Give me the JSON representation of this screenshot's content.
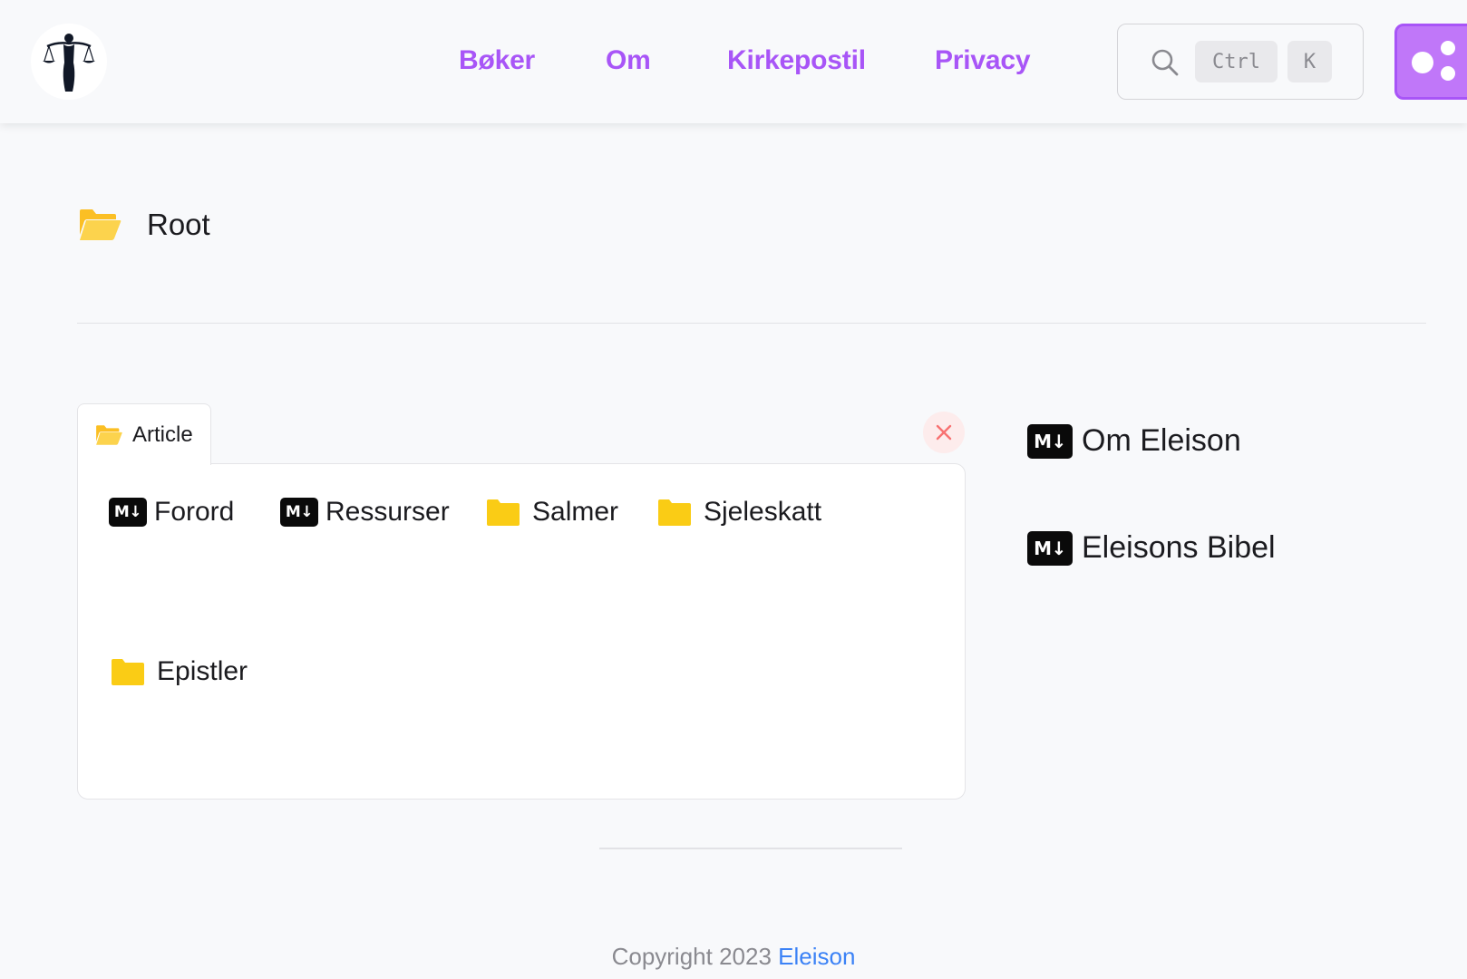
{
  "header": {
    "nav": [
      {
        "label": "Bøker"
      },
      {
        "label": "Om"
      },
      {
        "label": "Kirkepostil"
      },
      {
        "label": "Privacy"
      }
    ],
    "search": {
      "kbd_ctrl": "Ctrl",
      "kbd_k": "K"
    }
  },
  "root": {
    "label": "Root"
  },
  "article": {
    "tab_label": "Article",
    "items": [
      {
        "label": "Forord",
        "icon": "markdown-icon"
      },
      {
        "label": "Ressurser",
        "icon": "markdown-icon"
      },
      {
        "label": "Salmer",
        "icon": "folder-icon"
      },
      {
        "label": "Sjeleskatt",
        "icon": "folder-icon"
      },
      {
        "label": "Epistler",
        "icon": "folder-icon"
      }
    ]
  },
  "sidebar": {
    "items": [
      {
        "label": "Om Eleison",
        "icon": "markdown-icon"
      },
      {
        "label": "Eleisons Bibel",
        "icon": "markdown-icon"
      }
    ]
  },
  "icons": {
    "md_text": "M↓",
    "close": "×"
  },
  "footer": {
    "copyright": "Copyright 2023 ",
    "link": "Eleison"
  },
  "colors": {
    "accent": "#a855f7",
    "folder": "#facc15",
    "link": "#3b82f6",
    "close": "#f87171"
  }
}
